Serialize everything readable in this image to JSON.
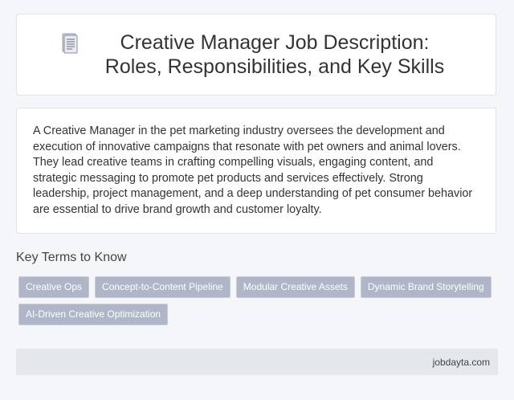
{
  "header": {
    "icon": "document-icon",
    "title": "Creative Manager Job Description: Roles, Responsibilities, and Key Skills"
  },
  "description": "A Creative Manager in the pet marketing industry oversees the development and execution of innovative campaigns that resonate with pet owners and animal lovers. They lead creative teams in crafting compelling visuals, engaging content, and strategic messaging to promote pet products and services effectively. Strong leadership, project management, and a deep understanding of pet consumer behavior are essential to drive brand growth and customer loyalty.",
  "key_terms": {
    "title": "Key Terms to Know",
    "items": [
      "Creative Ops",
      "Concept-to-Content Pipeline",
      "Modular Creative Assets",
      "Dynamic Brand Storytelling",
      "AI-Driven Creative Optimization"
    ]
  },
  "footer": {
    "site": "jobdayta.com"
  },
  "colors": {
    "tag_background": "#b0b6c8",
    "footer_background": "#e4e8ec",
    "page_background": "#f4f6f9"
  }
}
